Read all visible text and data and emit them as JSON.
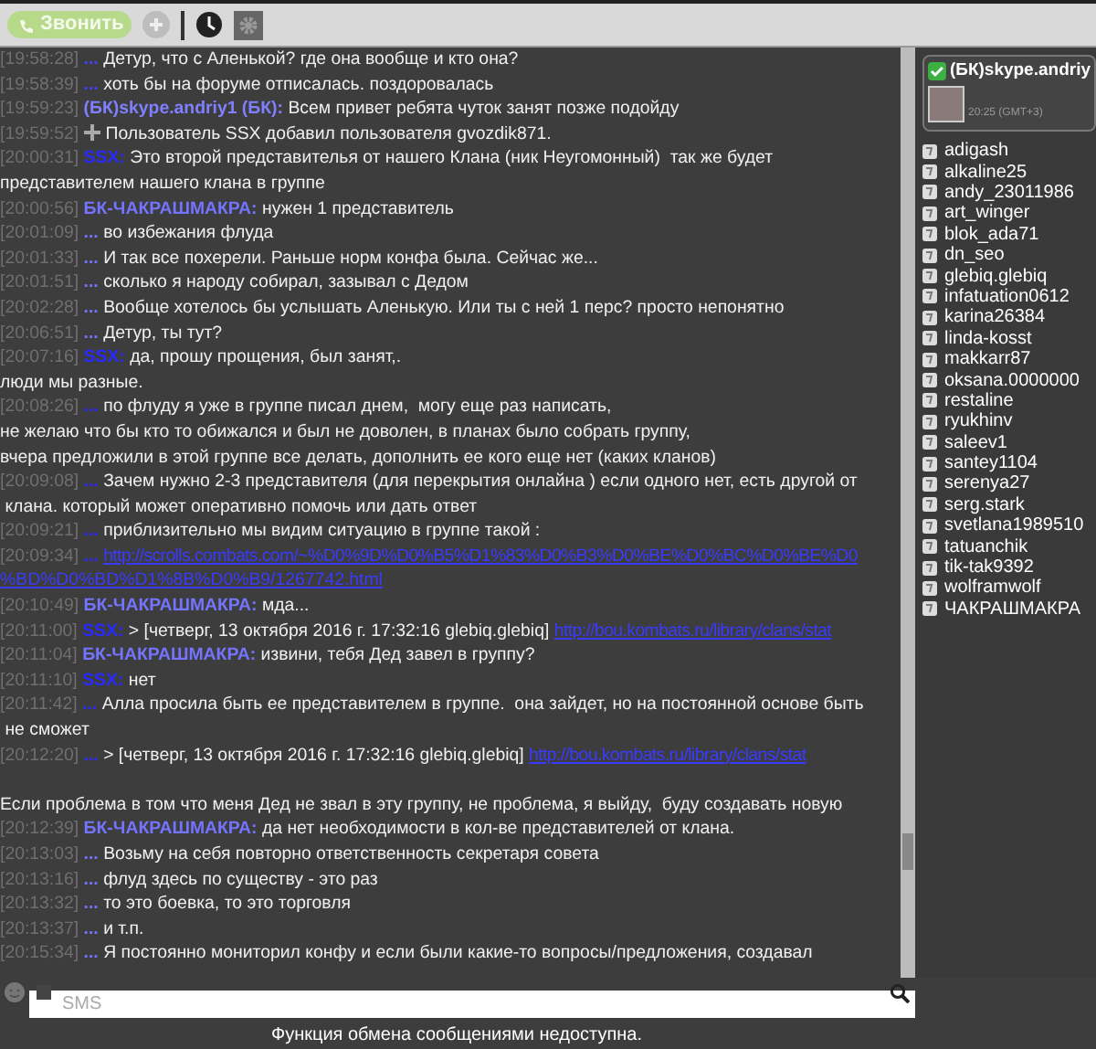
{
  "toolbar": {
    "call_button": "Звонить"
  },
  "messages": [
    {
      "time": "[19:58:28]",
      "author": "...",
      "color": "#4040ff",
      "text": "Детур, что с Аленькой? где она вообще и кто она?"
    },
    {
      "time": "[19:58:39]",
      "author": "...",
      "color": "#4040ff",
      "text": "хоть бы на форуме отписалась. поздоровалась"
    },
    {
      "time": "[19:59:23]",
      "author": "(БК)skype.andriy1 (БК):",
      "color": "#8080ff",
      "text": "Всем привет ребята чуток занят позже подойду"
    },
    {
      "time": "[19:59:52]",
      "kind": "system",
      "text": "Пользователь SSX добавил пользователя gvozdik871."
    },
    {
      "time": "[20:00:31]",
      "author": "SSX:",
      "color": "#2a2aff",
      "text": "Это второй представителья от нашего Клана (ник Неугомонный)  так же будет\nпредставителем нашего клана в группе"
    },
    {
      "time": "[20:00:56]",
      "author": "БК-ЧАКРАШМАКРА:",
      "color": "#7474ff",
      "text": "нужен 1 представитель"
    },
    {
      "time": "[20:01:09]",
      "author": "...",
      "color": "#7474ff",
      "text": "во избежания флуда"
    },
    {
      "time": "[20:01:33]",
      "author": "...",
      "color": "#7474ff",
      "text": "И так все похерели. Раньше норм конфа была. Сейчас же..."
    },
    {
      "time": "[20:01:51]",
      "author": "...",
      "color": "#7474ff",
      "text": "сколько я народу собирал, зазывал с Дедом"
    },
    {
      "time": "[20:02:28]",
      "author": "...",
      "color": "#7474ff",
      "text": "Вообще хотелось бы услышать Аленькую. Или ты с ней 1 перс? просто непонятно"
    },
    {
      "time": "[20:06:51]",
      "author": "...",
      "color": "#7474ff",
      "text": "Детур, ты тут?"
    },
    {
      "time": "[20:07:16]",
      "author": "SSX:",
      "color": "#2a2aff",
      "text": "да, прошу прощения, был занят,.\nлюди мы разные."
    },
    {
      "time": "[20:08:26]",
      "author": "...",
      "color": "#2a2aff",
      "text": "по флуду я уже в группе писал днем,  могу еще раз написать,\nне желаю что бы кто то обижался и был не доволен, в планах было собрать группу,\nвчера предложили в этой группе все делать, дополнить ее кого еще нет (каких кланов)"
    },
    {
      "time": "[20:09:08]",
      "author": "...",
      "color": "#2a2aff",
      "text": "Зачем нужно 2-3 представителя (для перекрытия онлайна ) если одного нет, есть другой от\n клана. который может оперативно помочь или дать ответ"
    },
    {
      "time": "[20:09:21]",
      "author": "...",
      "color": "#2a2aff",
      "text": "приблизительно мы видим ситуацию в группе такой :"
    },
    {
      "time": "[20:09:34]",
      "author": "...",
      "color": "#2a2aff",
      "link": [
        "http://scrolls.combats.com/~%D0%9D%D0%B5%D1%83%D0%B3%D0%BE%D0%BC%D0%BE%D0",
        "%BD%D0%BD%D1%8B%D0%B9/1267742.html"
      ]
    },
    {
      "time": "[20:10:49]",
      "author": "БК-ЧАКРАШМАКРА:",
      "color": "#7474ff",
      "text": "мда..."
    },
    {
      "time": "[20:11:00]",
      "author": "SSX:",
      "color": "#2a2aff",
      "text": "> [четверг, 13 октября 2016 г. 17:32:16 glebiq.glebiq]",
      "link": [
        "http://bou.kombats.ru/library/clans/stat"
      ]
    },
    {
      "time": "[20:11:04]",
      "author": "БК-ЧАКРАШМАКРА:",
      "color": "#7474ff",
      "text": "извини, тебя Дед завел в группу?"
    },
    {
      "time": "[20:11:10]",
      "author": "SSX:",
      "color": "#2a2aff",
      "text": "нет"
    },
    {
      "time": "[20:11:42]",
      "author": "...",
      "color": "#2a2aff",
      "text": "Алла просила быть ее представителем в группе.  она зайдет, но на постоянной основе быть\n не сможет"
    },
    {
      "time": "[20:12:20]",
      "author": "...",
      "color": "#2a2aff",
      "text": "> [четверг, 13 октября 2016 г. 17:32:16 glebiq.glebiq]",
      "link": [
        "http://bou.kombats.ru/library/clans/stat"
      ],
      "text_after": "\n\nЕсли проблема в том что меня Дед не звал в эту группу, не проблема, я выйду,  буду создавать новую"
    },
    {
      "time": "[20:12:39]",
      "author": "БК-ЧАКРАШМАКРА:",
      "color": "#7474ff",
      "text": "да нет необходимости в кол-ве представителей от клана."
    },
    {
      "time": "[20:13:03]",
      "author": "...",
      "color": "#7474ff",
      "text": "Возьму на себя повторно ответственность секретаря совета"
    },
    {
      "time": "[20:13:16]",
      "author": "...",
      "color": "#7474ff",
      "text": "флуд здесь по существу - это раз"
    },
    {
      "time": "[20:13:32]",
      "author": "...",
      "color": "#7474ff",
      "text": "то это боевка, то это торговля"
    },
    {
      "time": "[20:13:37]",
      "author": "...",
      "color": "#7474ff",
      "text": "и т.п."
    },
    {
      "time": "[20:15:34]",
      "author": "...",
      "color": "#7474ff",
      "text": "Я постоянно мониторил конфу и если были какие-то вопросы/предложения, создавал"
    }
  ],
  "contact_card": {
    "name": "(БК)skype.andriy",
    "local_time": "20:25 (GMT+3)"
  },
  "participants": [
    "adigash",
    "alkaline25",
    "andy_23011986",
    "art_winger",
    "blok_ada71",
    "dn_seo",
    "glebiq.glebiq",
    "infatuation0612",
    "karina26384",
    "linda-kosst",
    "makkarr87",
    "oksana.0000000",
    "restaline",
    "ryukhinv",
    "saleev1",
    "santey1104",
    "serenya27",
    "serg.stark",
    "svetlana1989510",
    "tatuanchik",
    "tik-tak9392",
    "wolframwolf",
    "ЧАКРАШМАКРА"
  ],
  "message_input": {
    "placeholder": "SMS"
  },
  "footer": "Функция обмена сообщениями недоступна."
}
